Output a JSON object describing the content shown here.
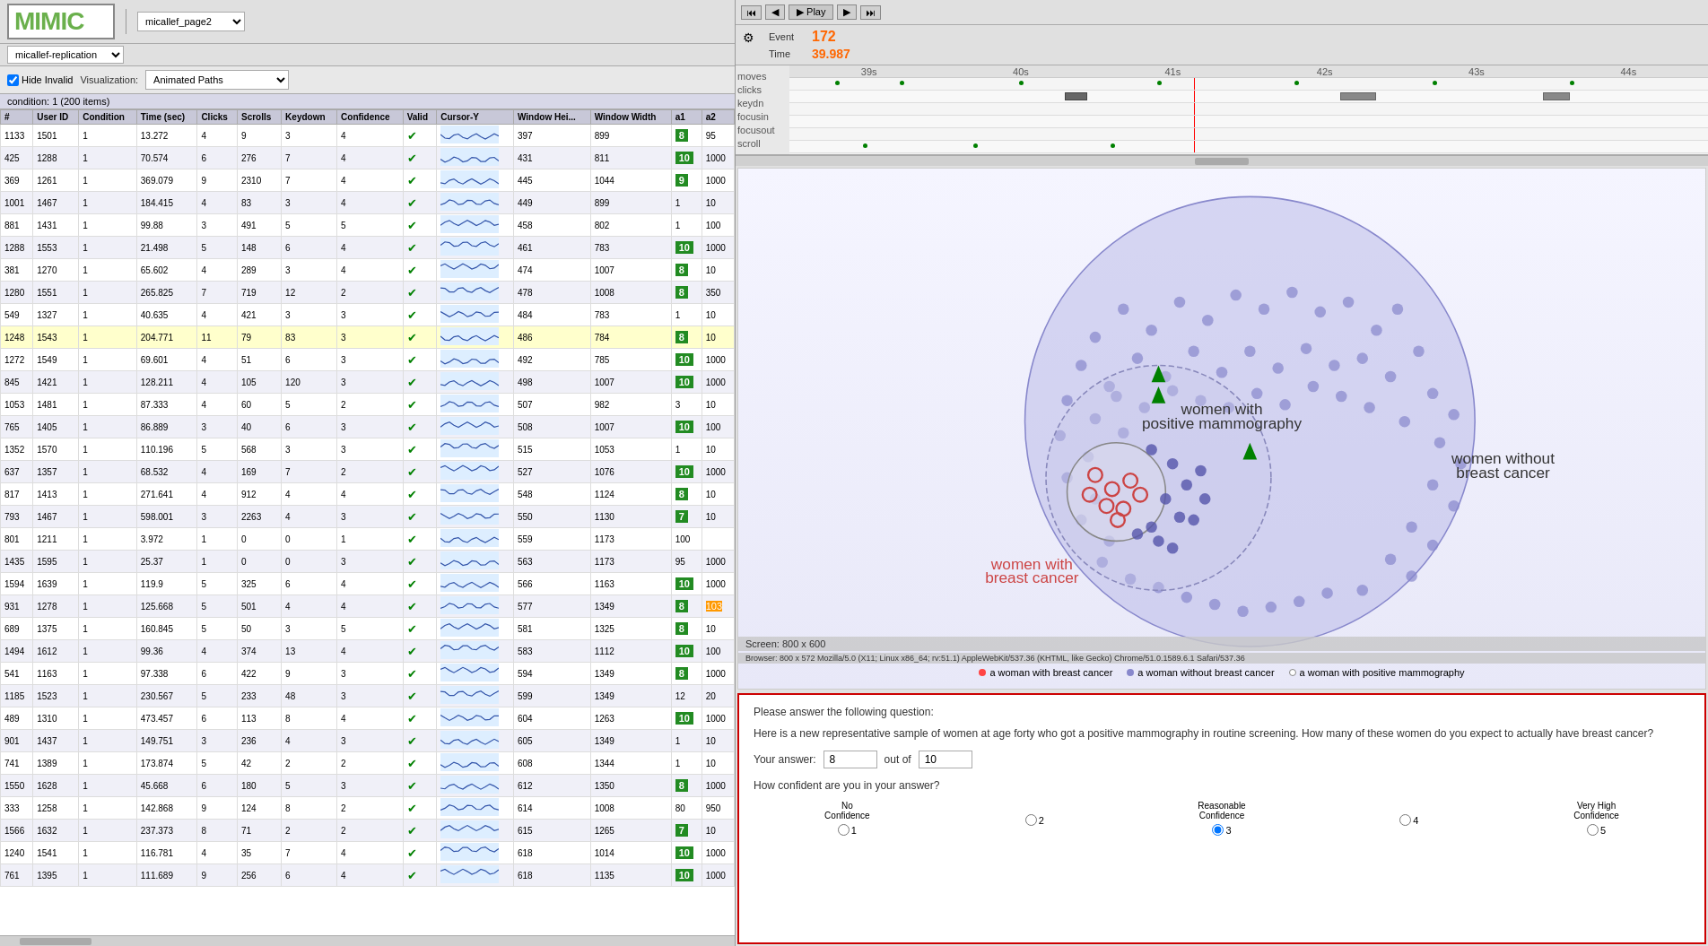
{
  "app": {
    "logo": "MIMIC",
    "page_dropdown": "micallef_page2",
    "replication": "micallef-replication",
    "hide_invalid_checked": true,
    "hide_invalid_label": "Hide Invalid",
    "viz_label": "Visualization:",
    "viz_value": "Animated Paths"
  },
  "playback": {
    "btn_start": "⏮",
    "btn_prev": "⏴",
    "btn_play": "▶ Play",
    "btn_next": "⏵",
    "btn_end": "⏭",
    "event_label": "Event",
    "event_value": "172",
    "time_label": "Time",
    "time_value": "39.987"
  },
  "timeline": {
    "tracks": [
      "moves",
      "clicks",
      "keydn",
      "focusin",
      "focusout",
      "scroll"
    ],
    "timestamps": [
      "39s",
      "40s",
      "41s",
      "42s",
      "43s",
      "44s"
    ]
  },
  "table": {
    "condition_info": "condition: 1 (200 items)",
    "columns": [
      "#",
      "User ID",
      "Condition",
      "Time (sec)",
      "Clicks",
      "Scrolls",
      "Keydown",
      "Confidence",
      "Valid",
      "Cursor-Y",
      "Window Hei...",
      "Window Width",
      "a1",
      "a2"
    ],
    "rows": [
      {
        "num": "1133",
        "uid": "1501",
        "cond": "1",
        "time": "13.272",
        "clicks": "4",
        "scrolls": "9",
        "keydown": "3",
        "conf": "4",
        "valid": true,
        "cursory": "",
        "wh": "397",
        "ww": "899",
        "a1": "8",
        "a2": "95"
      },
      {
        "num": "425",
        "uid": "1288",
        "cond": "1",
        "time": "70.574",
        "clicks": "6",
        "scrolls": "276",
        "keydown": "7",
        "conf": "4",
        "valid": true,
        "cursory": "",
        "wh": "431",
        "ww": "811",
        "a1": "10",
        "a2": "1000"
      },
      {
        "num": "369",
        "uid": "1261",
        "cond": "1",
        "time": "369.079",
        "clicks": "9",
        "scrolls": "2310",
        "keydown": "7",
        "conf": "4",
        "valid": true,
        "cursory": "",
        "wh": "445",
        "ww": "1044",
        "a1": "9",
        "a2": "1000"
      },
      {
        "num": "1001",
        "uid": "1467",
        "cond": "1",
        "time": "184.415",
        "clicks": "4",
        "scrolls": "83",
        "keydown": "3",
        "conf": "4",
        "valid": true,
        "cursory": "",
        "wh": "449",
        "ww": "899",
        "a1": "1",
        "a2": "10"
      },
      {
        "num": "881",
        "uid": "1431",
        "cond": "1",
        "time": "99.88",
        "clicks": "3",
        "scrolls": "491",
        "keydown": "5",
        "conf": "5",
        "valid": true,
        "cursory": "",
        "wh": "458",
        "ww": "802",
        "a1": "1",
        "a2": "100"
      },
      {
        "num": "1288",
        "uid": "1553",
        "cond": "1",
        "time": "21.498",
        "clicks": "5",
        "scrolls": "148",
        "keydown": "6",
        "conf": "4",
        "valid": true,
        "cursory": "",
        "wh": "461",
        "ww": "783",
        "a1": "10",
        "a2": "1000"
      },
      {
        "num": "381",
        "uid": "1270",
        "cond": "1",
        "time": "65.602",
        "clicks": "4",
        "scrolls": "289",
        "keydown": "3",
        "conf": "4",
        "valid": true,
        "cursory": "",
        "wh": "474",
        "ww": "1007",
        "a1": "8",
        "a2": "10"
      },
      {
        "num": "1280",
        "uid": "1551",
        "cond": "1",
        "time": "265.825",
        "clicks": "7",
        "scrolls": "719",
        "keydown": "12",
        "conf": "2",
        "valid": true,
        "cursory": "",
        "wh": "478",
        "ww": "1008",
        "a1": "8",
        "a2": "350"
      },
      {
        "num": "549",
        "uid": "1327",
        "cond": "1",
        "time": "40.635",
        "clicks": "4",
        "scrolls": "421",
        "keydown": "3",
        "conf": "3",
        "valid": true,
        "cursory": "",
        "wh": "484",
        "ww": "783",
        "a1": "1",
        "a2": "10"
      },
      {
        "num": "1248",
        "uid": "1543",
        "cond": "1",
        "time": "204.771",
        "clicks": "11",
        "scrolls": "79",
        "keydown": "83",
        "conf": "3",
        "valid": true,
        "cursory": "",
        "wh": "486",
        "ww": "784",
        "a1": "8",
        "a2": "10",
        "highlight": true
      },
      {
        "num": "1272",
        "uid": "1549",
        "cond": "1",
        "time": "69.601",
        "clicks": "4",
        "scrolls": "51",
        "keydown": "6",
        "conf": "3",
        "valid": true,
        "cursory": "",
        "wh": "492",
        "ww": "785",
        "a1": "10",
        "a2": "1000"
      },
      {
        "num": "845",
        "uid": "1421",
        "cond": "1",
        "time": "128.211",
        "clicks": "4",
        "scrolls": "105",
        "keydown": "120",
        "conf": "3",
        "valid": true,
        "cursory": "",
        "wh": "498",
        "ww": "1007",
        "a1": "10",
        "a2": "1000"
      },
      {
        "num": "1053",
        "uid": "1481",
        "cond": "1",
        "time": "87.333",
        "clicks": "4",
        "scrolls": "60",
        "keydown": "5",
        "conf": "2",
        "valid": true,
        "cursory": "",
        "wh": "507",
        "ww": "982",
        "a1": "3",
        "a2": "10"
      },
      {
        "num": "765",
        "uid": "1405",
        "cond": "1",
        "time": "86.889",
        "clicks": "3",
        "scrolls": "40",
        "keydown": "6",
        "conf": "3",
        "valid": true,
        "cursory": "",
        "wh": "508",
        "ww": "1007",
        "a1": "10",
        "a2": "100"
      },
      {
        "num": "1352",
        "uid": "1570",
        "cond": "1",
        "time": "110.196",
        "clicks": "5",
        "scrolls": "568",
        "keydown": "3",
        "conf": "3",
        "valid": true,
        "cursory": "",
        "wh": "515",
        "ww": "1053",
        "a1": "1",
        "a2": "10"
      },
      {
        "num": "637",
        "uid": "1357",
        "cond": "1",
        "time": "68.532",
        "clicks": "4",
        "scrolls": "169",
        "keydown": "7",
        "conf": "2",
        "valid": true,
        "cursory": "",
        "wh": "527",
        "ww": "1076",
        "a1": "10",
        "a2": "1000"
      },
      {
        "num": "817",
        "uid": "1413",
        "cond": "1",
        "time": "271.641",
        "clicks": "4",
        "scrolls": "912",
        "keydown": "4",
        "conf": "4",
        "valid": true,
        "cursory": "",
        "wh": "548",
        "ww": "1124",
        "a1": "8",
        "a2": "10"
      },
      {
        "num": "793",
        "uid": "1467",
        "cond": "1",
        "time": "598.001",
        "clicks": "3",
        "scrolls": "2263",
        "keydown": "4",
        "conf": "3",
        "valid": true,
        "cursory": "",
        "wh": "550",
        "ww": "1130",
        "a1": "7",
        "a2": "10"
      },
      {
        "num": "801",
        "uid": "1211",
        "cond": "1",
        "time": "3.972",
        "clicks": "1",
        "scrolls": "0",
        "keydown": "0",
        "conf": "1",
        "valid": true,
        "cursory": "",
        "wh": "559",
        "ww": "1173",
        "a1": "100",
        "a2": ""
      },
      {
        "num": "1435",
        "uid": "1595",
        "cond": "1",
        "time": "25.37",
        "clicks": "1",
        "scrolls": "0",
        "keydown": "0",
        "conf": "3",
        "valid": true,
        "cursory": "",
        "wh": "563",
        "ww": "1173",
        "a1": "95",
        "a2": "1000"
      },
      {
        "num": "1594",
        "uid": "1639",
        "cond": "1",
        "time": "119.9",
        "clicks": "5",
        "scrolls": "325",
        "keydown": "6",
        "conf": "4",
        "valid": true,
        "cursory": "",
        "wh": "566",
        "ww": "1163",
        "a1": "10",
        "a2": "1000"
      },
      {
        "num": "931",
        "uid": "1278",
        "cond": "1",
        "time": "125.668",
        "clicks": "5",
        "scrolls": "501",
        "keydown": "4",
        "conf": "4",
        "valid": true,
        "cursory": "",
        "wh": "577",
        "ww": "1349",
        "a1": "8",
        "a2": "103"
      },
      {
        "num": "689",
        "uid": "1375",
        "cond": "1",
        "time": "160.845",
        "clicks": "5",
        "scrolls": "50",
        "keydown": "3",
        "conf": "5",
        "valid": true,
        "cursory": "",
        "wh": "581",
        "ww": "1325",
        "a1": "8",
        "a2": "10"
      },
      {
        "num": "1494",
        "uid": "1612",
        "cond": "1",
        "time": "99.36",
        "clicks": "4",
        "scrolls": "374",
        "keydown": "13",
        "conf": "4",
        "valid": true,
        "cursory": "",
        "wh": "583",
        "ww": "1112",
        "a1": "10",
        "a2": "100"
      },
      {
        "num": "541",
        "uid": "1163",
        "cond": "1",
        "time": "97.338",
        "clicks": "6",
        "scrolls": "422",
        "keydown": "9",
        "conf": "3",
        "valid": true,
        "cursory": "",
        "wh": "594",
        "ww": "1349",
        "a1": "8",
        "a2": "1000"
      },
      {
        "num": "1185",
        "uid": "1523",
        "cond": "1",
        "time": "230.567",
        "clicks": "5",
        "scrolls": "233",
        "keydown": "48",
        "conf": "3",
        "valid": true,
        "cursory": "",
        "wh": "599",
        "ww": "1349",
        "a1": "12",
        "a2": "20"
      },
      {
        "num": "489",
        "uid": "1310",
        "cond": "1",
        "time": "473.457",
        "clicks": "6",
        "scrolls": "113",
        "keydown": "8",
        "conf": "4",
        "valid": true,
        "cursory": "",
        "wh": "604",
        "ww": "1263",
        "a1": "10",
        "a2": "1000"
      },
      {
        "num": "901",
        "uid": "1437",
        "cond": "1",
        "time": "149.751",
        "clicks": "3",
        "scrolls": "236",
        "keydown": "4",
        "conf": "3",
        "valid": true,
        "cursory": "",
        "wh": "605",
        "ww": "1349",
        "a1": "1",
        "a2": "10"
      },
      {
        "num": "741",
        "uid": "1389",
        "cond": "1",
        "time": "173.874",
        "clicks": "5",
        "scrolls": "42",
        "keydown": "2",
        "conf": "2",
        "valid": true,
        "cursory": "",
        "wh": "608",
        "ww": "1344",
        "a1": "1",
        "a2": "10"
      },
      {
        "num": "1550",
        "uid": "1628",
        "cond": "1",
        "time": "45.668",
        "clicks": "6",
        "scrolls": "180",
        "keydown": "5",
        "conf": "3",
        "valid": true,
        "cursory": "",
        "wh": "612",
        "ww": "1350",
        "a1": "8",
        "a2": "1000"
      },
      {
        "num": "333",
        "uid": "1258",
        "cond": "1",
        "time": "142.868",
        "clicks": "9",
        "scrolls": "124",
        "keydown": "8",
        "conf": "2",
        "valid": true,
        "cursory": "",
        "wh": "614",
        "ww": "1008",
        "a1": "80",
        "a2": "950"
      },
      {
        "num": "1566",
        "uid": "1632",
        "cond": "1",
        "time": "237.373",
        "clicks": "8",
        "scrolls": "71",
        "keydown": "2",
        "conf": "2",
        "valid": true,
        "cursory": "",
        "wh": "615",
        "ww": "1265",
        "a1": "7",
        "a2": "10"
      },
      {
        "num": "1240",
        "uid": "1541",
        "cond": "1",
        "time": "116.781",
        "clicks": "4",
        "scrolls": "35",
        "keydown": "7",
        "conf": "4",
        "valid": true,
        "cursory": "",
        "wh": "618",
        "ww": "1014",
        "a1": "10",
        "a2": "1000"
      },
      {
        "num": "761",
        "uid": "1395",
        "cond": "1",
        "time": "111.689",
        "clicks": "9",
        "scrolls": "256",
        "keydown": "6",
        "conf": "4",
        "valid": true,
        "cursory": "",
        "wh": "618",
        "ww": "1135",
        "a1": "10",
        "a2": "1000"
      }
    ]
  },
  "visualization": {
    "screen_info": "Screen: 800 x 600",
    "browser_info": "Browser: 800 x 572 Mozilla/5.0 (X11; Linux x86_64; rv:51.1) AppleWebKit/537.36 (KHTML, like Gecko) Chrome/51.0.1589.6.1 Safari/537.36",
    "labels": {
      "women_positive_mammo": "women with positive mammography",
      "women_breast_cancer": "women with breast cancer",
      "women_without": "women without breast cancer"
    },
    "legend": [
      {
        "label": "a woman with breast cancer",
        "type": "red"
      },
      {
        "label": "a woman without breast cancer",
        "type": "blue"
      },
      {
        "label": "a woman with positive mammography",
        "type": "white"
      }
    ]
  },
  "survey": {
    "question_header": "Please answer the following question:",
    "question_text": "Here is a new representative sample of women at age forty who got a positive mammography in routine screening. How many of these women do you expect to actually have breast cancer?",
    "answer_label": "Your answer:",
    "answer_value": "8",
    "out_of_label": "out of",
    "out_of_value": "10",
    "confidence_question": "How confident are you in your answer?",
    "confidence_levels": [
      {
        "label": "No\nConfidence",
        "options": [
          {
            "value": "1",
            "selected": false
          }
        ]
      },
      {
        "label": "",
        "options": [
          {
            "value": "2",
            "selected": false
          }
        ]
      },
      {
        "label": "Reasonable\nConfidence",
        "options": [
          {
            "value": "3",
            "selected": true
          }
        ]
      },
      {
        "label": "",
        "options": [
          {
            "value": "4",
            "selected": false
          }
        ]
      },
      {
        "label": "Very High\nConfidence",
        "options": [
          {
            "value": "5",
            "selected": false
          }
        ]
      }
    ]
  }
}
